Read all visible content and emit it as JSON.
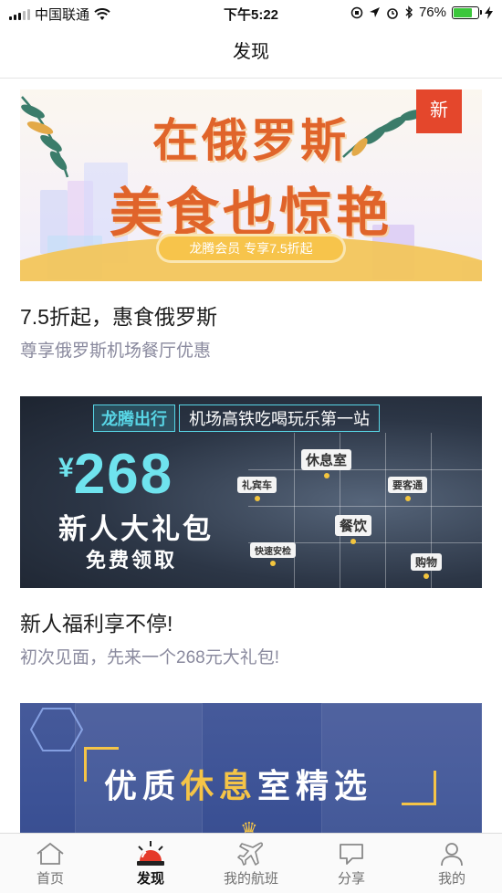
{
  "status_bar": {
    "carrier": "中国联通",
    "time": "下午5:22",
    "battery_percent": "76%",
    "battery_level": 0.76
  },
  "nav": {
    "title": "发现"
  },
  "cards": [
    {
      "title": "7.5折起，惠食俄罗斯",
      "subtitle": "尊享俄罗斯机场餐厅优惠",
      "banner": {
        "headline_1": "在俄罗斯",
        "headline_2": "美食也惊艳",
        "pill": "龙腾会员 专享7.5折起",
        "badge": "新"
      }
    },
    {
      "title": "新人福利享不停!",
      "subtitle": "初次见面，先来一个268元大礼包!",
      "banner": {
        "brand": "龙腾出行",
        "slogan": "机场高铁吃喝玩乐第一站",
        "currency": "¥",
        "amount": "268",
        "gift": "新人大礼包",
        "free": "免费领取",
        "tags": [
          "休息室",
          "礼宾车",
          "要客通",
          "餐饮",
          "快速安检",
          "购物"
        ]
      }
    },
    {
      "banner": {
        "headline_a": "优质",
        "headline_b": "休息",
        "headline_c": "室",
        "headline_d": "精选"
      }
    }
  ],
  "tab_bar": {
    "items": [
      {
        "label": "首页",
        "icon": "home-icon"
      },
      {
        "label": "发现",
        "icon": "siren-icon",
        "active": true
      },
      {
        "label": "我的航班",
        "icon": "airplane-icon"
      },
      {
        "label": "分享",
        "icon": "chat-bubble-icon"
      },
      {
        "label": "我的",
        "icon": "person-icon"
      }
    ]
  },
  "colors": {
    "accent_orange": "#e0642a",
    "badge_red": "#e4472c",
    "teal": "#58d6e6",
    "gold": "#f5c447"
  }
}
